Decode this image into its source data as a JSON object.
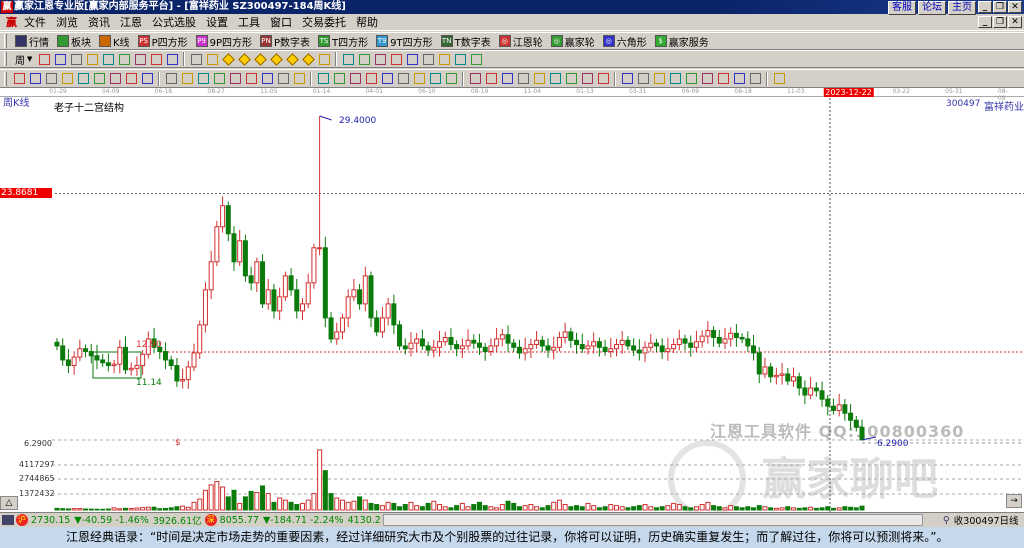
{
  "titlebar": {
    "title": "赢家江恩专业版[赢家内部服务平台] - [富祥药业   SZ300497-184周K线]",
    "links": [
      "客服",
      "论坛",
      "主页"
    ],
    "logo": "赢"
  },
  "menu": {
    "logo": "赢",
    "items": [
      "文件",
      "浏览",
      "资讯",
      "江恩",
      "公式选股",
      "设置",
      "工具",
      "窗口",
      "交易委托",
      "帮助"
    ]
  },
  "toolbar1": [
    {
      "icon": "grid-icon",
      "label": "行情",
      "color": "#336"
    },
    {
      "icon": "blocks-icon",
      "label": "板块",
      "color": "#393"
    },
    {
      "icon": "kline-icon",
      "label": "K线",
      "color": "#c60"
    },
    {
      "icon": "ps-icon",
      "label": "P四方形",
      "badge": "PS",
      "color": "#c33"
    },
    {
      "icon": "p9-icon",
      "label": "9P四方形",
      "badge": "P9",
      "color": "#c3c"
    },
    {
      "icon": "pn-icon",
      "label": "P数字表",
      "badge": "PN",
      "color": "#933"
    },
    {
      "icon": "ts-icon",
      "label": "T四方形",
      "badge": "TS",
      "color": "#393"
    },
    {
      "icon": "t9-icon",
      "label": "9T四方形",
      "badge": "T9",
      "color": "#39c"
    },
    {
      "icon": "tn-icon",
      "label": "T数字表",
      "badge": "TN",
      "color": "#363"
    },
    {
      "icon": "gann-wheel-icon",
      "label": "江恩轮",
      "badge": "◎",
      "color": "#c33"
    },
    {
      "icon": "winner-wheel-icon",
      "label": "赢家轮",
      "badge": "◎",
      "color": "#393"
    },
    {
      "icon": "hexagon-icon",
      "label": "六角形",
      "badge": "◎",
      "color": "#33c"
    },
    {
      "icon": "dollar-icon",
      "label": "赢家服务",
      "badge": "$",
      "color": "#3a3"
    }
  ],
  "toolbar2": {
    "period": "周",
    "icons": [
      "chart-icon",
      "list-icon",
      "bars-icon",
      "bars2-icon",
      "candle-icon",
      "rights-icon",
      "flag-icon",
      "first-icon",
      "last-icon",
      "prev-icon",
      "next-icon",
      "diamond1-icon",
      "diamond2-icon",
      "diamond3-icon",
      "diamond4-icon",
      "diamond5-icon",
      "diamond6-icon",
      "hand-icon",
      "crosshair-icon",
      "wave-icon",
      "node-icon",
      "calc1-icon",
      "calendar-icon",
      "calculator-icon",
      "book-icon",
      "save-icon",
      "truck-icon"
    ]
  },
  "toolbar3": {
    "icons": [
      "pen-icon",
      "grid-lines-icon",
      "gold1-icon",
      "gold2-icon",
      "fork-icon",
      "arc-icon",
      "draw-icon",
      "circle-icon",
      "hash-icon",
      "n2-icon",
      "angle-icon",
      "target-icon",
      "star-icon",
      "box-icon",
      "wedge-icon",
      "red-grid-icon",
      "red-box-icon",
      "mesh-icon",
      "range-icon",
      "square-icon",
      "fan-icon",
      "web-icon",
      "spiral-icon",
      "angle2-icon",
      "zigzag-icon",
      "table-icon",
      "table2-icon",
      "lines-icon",
      "b-icon",
      "z-icon",
      "r-icon",
      "percent-icon",
      "pct-line-icon",
      "coin-icon",
      "gold-line-icon",
      "pen2-icon",
      "t-line-icon",
      "gold-t-icon",
      "fan2-icon",
      "fan3-icon",
      "fan4-icon",
      "fan5-icon",
      "fan6-icon",
      "fan7-icon",
      "yinyang-icon",
      "infinity-icon"
    ]
  },
  "chart": {
    "period_label": "周K线",
    "study_label": "老子十二宫结构",
    "code": "300497",
    "name": "富祥药业",
    "dates": [
      "01-29",
      "04-09",
      "06-18",
      "08-27",
      "11-05",
      "01-14",
      "04-01",
      "06-10",
      "08-19",
      "11-04",
      "01-13",
      "03-31",
      "06-09",
      "08-18",
      "11-03",
      "2023-12-22",
      "03-22",
      "05-31",
      "08-09"
    ],
    "highlight_date": "2023-12-22",
    "price_tag": "23.8681",
    "max_label": "29.4000",
    "max_value": 29.4,
    "min_label": "6.2900",
    "min_value": 6.29,
    "box_top_label": "12.90",
    "box_bottom_label": "11.14",
    "marker": "$",
    "vol_axis": [
      "6.2900",
      "4117297",
      "2744865",
      "1372432"
    ],
    "watermark1": "江恩工具软件  QQ:100800360",
    "watermark2": "赢家聊吧",
    "colors": {
      "up": "#d23030",
      "down": "#0a7a0a",
      "accent": "#e00000"
    }
  },
  "chart_data": {
    "type": "candlestick",
    "title": "SZ300497 富祥药业 周K线",
    "ylim": [
      6.29,
      29.4
    ],
    "closes": [
      13,
      12,
      11.6,
      12.2,
      12.8,
      12.6,
      12.3,
      12,
      11.8,
      11.6,
      11.7,
      12.9,
      11.3,
      11.4,
      11.6,
      12.4,
      13.5,
      12.9,
      12.6,
      12,
      11.6,
      10.5,
      10.6,
      11.5,
      12.5,
      14.5,
      17,
      19,
      21.5,
      23,
      21,
      19,
      20.5,
      18,
      17.5,
      19,
      16,
      17,
      15.5,
      16.5,
      18,
      17,
      15.5,
      16,
      17.5,
      20,
      20,
      15,
      13.5,
      14,
      15,
      16.5,
      17,
      16,
      18,
      15,
      14,
      15,
      16,
      14.5,
      13,
      12.8,
      13.2,
      13.5,
      13,
      12.7,
      12.9,
      13.3,
      13.6,
      13.1,
      12.8,
      13,
      13.4,
      13.2,
      12.9,
      12.6,
      13,
      13.5,
      13.8,
      13.2,
      12.9,
      12.5,
      12.8,
      13.1,
      13.4,
      13,
      12.7,
      12.9,
      13.6,
      14,
      13.4,
      13.1,
      12.8,
      13,
      13.3,
      12.9,
      12.6,
      12.8,
      13.1,
      13.4,
      13,
      12.7,
      12.5,
      12.9,
      13.2,
      13,
      12.6,
      12.8,
      13.1,
      13.5,
      13.2,
      12.9,
      13.3,
      13.7,
      14.1,
      13.6,
      13.2,
      13.5,
      13.9,
      13.6,
      13.5,
      13,
      12.5,
      11,
      11.5,
      10.8,
      10.9,
      11,
      10.5,
      10.8,
      10,
      9.5,
      10,
      9.8,
      9.2,
      8.7,
      8.4,
      8.8,
      8.2,
      7.7,
      7.2,
      6.3
    ],
    "spike_index": 46,
    "volume_unit": 1000,
    "volumes": [
      150,
      120,
      100,
      140,
      130,
      90,
      80,
      70,
      60,
      90,
      200,
      110,
      150,
      140,
      180,
      220,
      250,
      260,
      120,
      140,
      200,
      300,
      350,
      250,
      700,
      1000,
      1800,
      2300,
      2600,
      2100,
      1200,
      1800,
      600,
      1200,
      1700,
      1600,
      2200,
      1500,
      700,
      1100,
      900,
      700,
      500,
      600,
      900,
      1500,
      5500,
      3600,
      1500,
      1100,
      900,
      700,
      800,
      1200,
      900,
      600,
      500,
      400,
      700,
      600,
      300,
      500,
      700,
      400,
      300,
      600,
      800,
      500,
      300,
      200,
      400,
      600,
      300,
      500,
      700,
      400,
      300,
      200,
      500,
      800,
      600,
      300,
      400,
      500,
      300,
      200,
      400,
      700,
      900,
      500,
      300,
      400,
      300,
      600,
      400,
      200,
      300,
      500,
      400,
      300,
      200,
      300,
      400,
      500,
      300,
      200,
      300,
      400,
      600,
      500,
      300,
      200,
      300,
      500,
      700,
      400,
      300,
      200,
      400,
      300,
      200,
      300,
      200,
      400,
      300,
      200,
      150,
      200,
      300,
      200,
      150,
      200,
      250,
      150,
      200,
      300,
      150,
      200,
      300,
      250,
      200,
      350
    ]
  },
  "status": {
    "sh_icon": "沪",
    "sh_index": "2730.15",
    "sh_change": "▼-40.59 -1.46%",
    "sh_amount": "3926.61亿",
    "sz_icon": "深",
    "sz_index": "8055.77",
    "sz_change": "▼-184.71 -2.24%",
    "sz_amount": "4130.2",
    "right_text": "收300497日线"
  },
  "quote": "江恩经典语录：“时间是决定市场走势的重要因素，经过详细研究大市及个别股票的过往记录，你将可以证明，历史确实重复发生；而了解过往，你将可以预测将来。”。"
}
